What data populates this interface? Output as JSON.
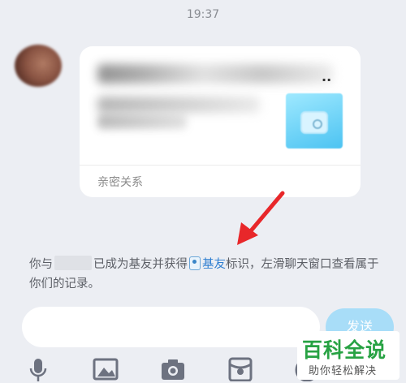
{
  "chat": {
    "timestamp": "19:37",
    "card": {
      "title_suffix": "..",
      "footer": "亲密关系"
    },
    "notice": {
      "prefix": "你与",
      "middle": "已成为基友并获得",
      "badge": "基友",
      "suffix": "标识，左滑聊天窗口查看属于你们的记录。"
    }
  },
  "composer": {
    "send_label": "发送"
  },
  "toolbar": {
    "icons": [
      "microphone-icon",
      "image-icon",
      "camera-icon",
      "red-packet-icon",
      "emoji-icon"
    ]
  },
  "watermark": {
    "title": "百科全说",
    "subtitle": "助你轻松解决"
  },
  "colors": {
    "background": "#eceef3",
    "link": "#2f7fd1",
    "send": "#a8ddf8",
    "arrow": "#e8272a",
    "watermark": "#27a243"
  }
}
